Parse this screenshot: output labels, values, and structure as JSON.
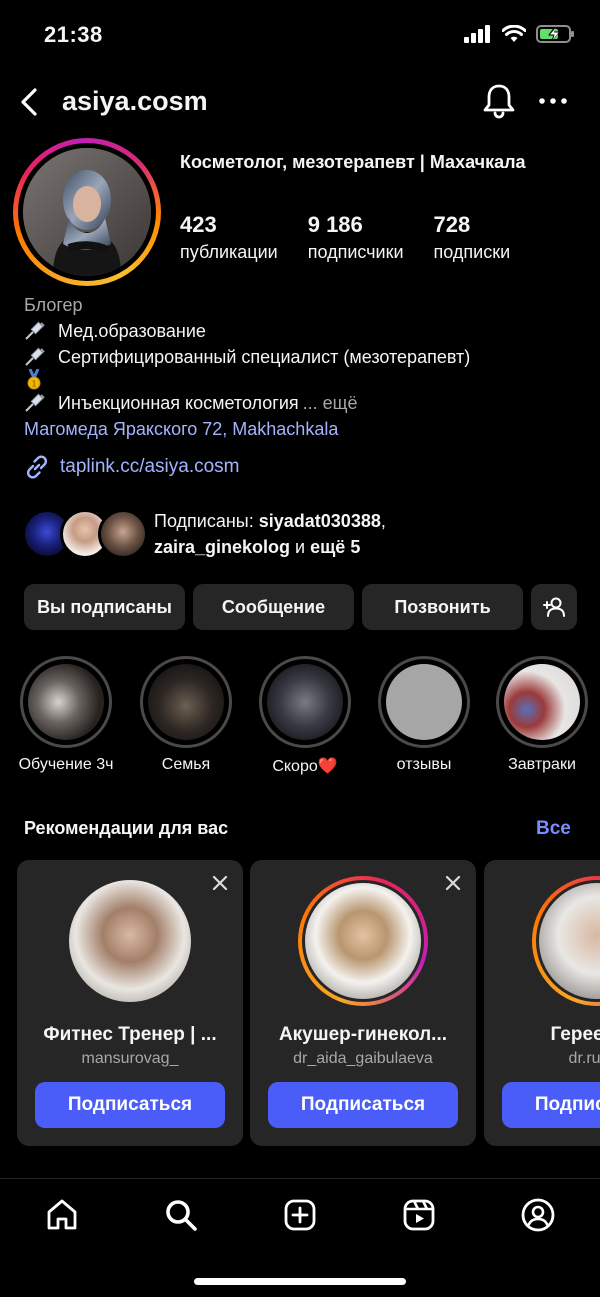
{
  "status": {
    "time": "21:38"
  },
  "header": {
    "username": "asiya.cosm"
  },
  "profile": {
    "title": "Косметолог, мезотерапевт | Махачкала",
    "stats": [
      {
        "value": "423",
        "label": "публикации"
      },
      {
        "value": "9 186",
        "label": "подписчики"
      },
      {
        "value": "728",
        "label": "подписки"
      }
    ],
    "category": "Блогер",
    "bio_lines": [
      "Мед.образование",
      "Сертифицированный специалист (мезотерапевт)",
      "Инъекционная косметология"
    ],
    "bio_more": "... ещё",
    "address": "Магомеда Яракского 72, Makhachkala",
    "link": "taplink.cc/asiya.cosm",
    "followed_by_prefix": "Подписаны: ",
    "followed_by_user1": "siyadat030388",
    "followed_by_user2": "zaira_ginekolog",
    "followed_by_mid": " и ",
    "followed_by_more": "ещё 5"
  },
  "actions": {
    "following": "Вы подписаны",
    "message": "Сообщение",
    "call": "Позвонить"
  },
  "highlights": [
    {
      "label": "Обучение 3ч"
    },
    {
      "label": "Семья"
    },
    {
      "label": "Скоро❤️"
    },
    {
      "label": "отзывы"
    },
    {
      "label": "Завтраки"
    }
  ],
  "recommendations": {
    "title": "Рекомендации для вас",
    "see_all": "Все",
    "follow_label": "Подписаться",
    "cards": [
      {
        "name": "Фитнес Тренер | ...",
        "username": "mansurovag_"
      },
      {
        "name": "Акушер-гинекол...",
        "username": "dr_aida_gaibulaeva"
      },
      {
        "name": "Гереева Р",
        "username": "dr.rumiy"
      }
    ]
  },
  "icons": {
    "back": "chevron-left-icon",
    "bell": "bell-icon",
    "more": "more-horizontal-icon",
    "link": "link-icon",
    "add_user": "add-user-icon",
    "close": "close-icon",
    "tabs": [
      "home-icon",
      "search-icon",
      "create-icon",
      "reels-icon",
      "profile-icon"
    ]
  },
  "colors": {
    "accent": "#4a5df9",
    "link": "#a3b4ff",
    "see_all": "#7a8cff",
    "button_bg": "#262626"
  }
}
